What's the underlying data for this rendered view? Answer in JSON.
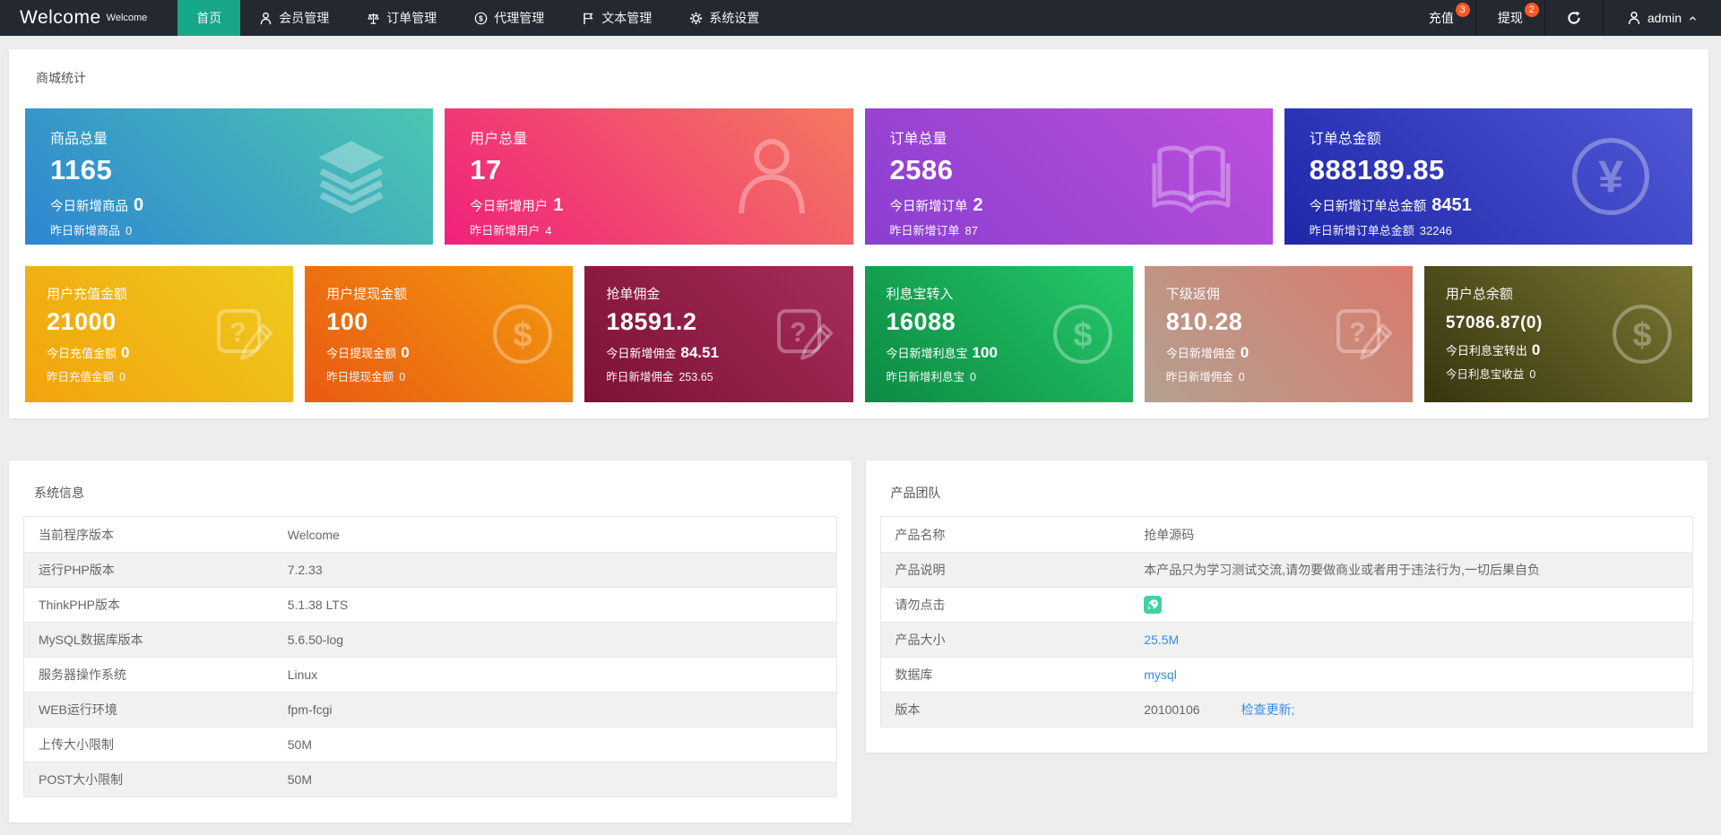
{
  "colors": {
    "accent": "#18a689",
    "badge": "#ff5722",
    "link_blue": "#3b8cde",
    "navbar_bg": "#242830",
    "page_bg": "#ededee",
    "rocket_button": "#3ed3a3"
  },
  "navbar": {
    "logo": "Welcome",
    "logo_sup": "Welcome",
    "menu": [
      {
        "label": "首页"
      },
      {
        "label": "会员管理"
      },
      {
        "label": "订单管理"
      },
      {
        "label": "代理管理"
      },
      {
        "label": "文本管理"
      },
      {
        "label": "系统设置"
      }
    ],
    "recharge_label": "充值",
    "recharge_badge": "3",
    "withdraw_label": "提现",
    "withdraw_badge": "2",
    "username": "admin"
  },
  "stats": {
    "title": "商城统计",
    "row1": [
      {
        "title": "商品总量",
        "value": "1165",
        "l1": "今日新增商品",
        "v1": "0",
        "l2": "昨日新增商品",
        "v2": "0",
        "background": "linear-gradient(45deg,#2E86D2,#4BC7B0)"
      },
      {
        "title": "用户总量",
        "value": "17",
        "l1": "今日新增用户",
        "v1": "1",
        "l2": "昨日新增用户",
        "v2": "4",
        "background": "linear-gradient(45deg,#F0217C,#F47960)"
      },
      {
        "title": "订单总量",
        "value": "2586",
        "l1": "今日新增订单",
        "v1": "2",
        "l2": "昨日新增订单",
        "v2": "87",
        "background": "linear-gradient(45deg,#8A3FD0,#BD4FDC)"
      },
      {
        "title": "订单总金额",
        "value": "888189.85",
        "l1": "今日新增订单总金额",
        "v1": "8451",
        "l2": "昨日新增订单总金额",
        "v2": "32246",
        "background": "linear-gradient(45deg,#1E27A8,#5058D6)"
      }
    ],
    "row2": [
      {
        "title": "用户充值金额",
        "value": "21000",
        "l1": "今日充值金额",
        "v1": "0",
        "l2": "昨日充值金额",
        "v2": "0",
        "background": "linear-gradient(45deg,#F2A30D,#EFCA1D)"
      },
      {
        "title": "用户提现金额",
        "value": "100",
        "l1": "今日提现金额",
        "v1": "0",
        "l2": "昨日提现金额",
        "v2": "0",
        "background": "linear-gradient(45deg,#EA5A12,#F2990E)"
      },
      {
        "title": "抢单佣金",
        "value": "18591.2",
        "l1": "今日新增佣金",
        "v1": "84.51",
        "l2": "昨日新增佣金",
        "v2": "253.65",
        "background": "linear-gradient(45deg,#7D1134,#A62D5B)"
      },
      {
        "title": "利息宝转入",
        "value": "16088",
        "l1": "今日新增利息宝",
        "v1": "100",
        "l2": "昨日新增利息宝",
        "v2": "0",
        "background": "linear-gradient(45deg,#0C8A43,#25C96A)"
      },
      {
        "title": "下级返佣",
        "value": "810.28",
        "l1": "今日新增佣金",
        "v1": "0",
        "l2": "昨日新增佣金",
        "v2": "0",
        "background": "linear-gradient(45deg,#B4A090,#DA7A6C)"
      },
      {
        "title": "用户总余额",
        "value": "57086.87(0)",
        "l1": "今日利息宝转出",
        "v1": "0",
        "l2": "今日利息宝收益",
        "v2": "0",
        "background": "linear-gradient(45deg,#37350F,#7C7733)"
      }
    ]
  },
  "system_info": {
    "title": "系统信息",
    "rows": [
      {
        "label": "当前程序版本",
        "value": "Welcome"
      },
      {
        "label": "运行PHP版本",
        "value": "7.2.33"
      },
      {
        "label": "ThinkPHP版本",
        "value": "5.1.38 LTS"
      },
      {
        "label": "MySQL数据库版本",
        "value": "5.6.50-log"
      },
      {
        "label": "服务器操作系统",
        "value": "Linux"
      },
      {
        "label": "WEB运行环境",
        "value": "fpm-fcgi"
      },
      {
        "label": "上传大小限制",
        "value": "50M"
      },
      {
        "label": "POST大小限制",
        "value": "50M"
      }
    ]
  },
  "product_team": {
    "title": "产品团队",
    "rows": [
      {
        "label": "产品名称",
        "value": "抢单源码"
      },
      {
        "label": "产品说明",
        "value": "本产品只为学习测试交流,请勿要做商业或者用于违法行为,一切后果自负"
      },
      {
        "label": "请勿点击",
        "value": ""
      },
      {
        "label": "产品大小",
        "value": "25.5M"
      },
      {
        "label": "数据库",
        "value": "mysql"
      },
      {
        "label": "版本",
        "value": "20100106",
        "extra": "检查更新;"
      }
    ]
  }
}
